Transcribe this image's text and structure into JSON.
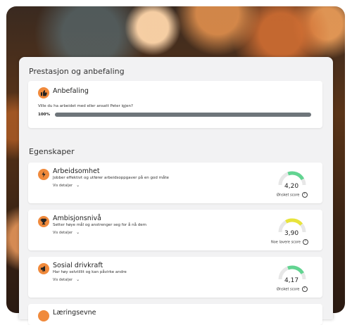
{
  "sections": {
    "performance_title": "Prestasjon og anbefaling",
    "traits_title": "Egenskaper"
  },
  "recommendation": {
    "title": "Anbefaling",
    "question": "Ville du ha arbeidet med eller ansatt Peter igjen?",
    "percent_label": "100%",
    "percent_value": 1.0,
    "icon": "thumbs-up-icon"
  },
  "traits": [
    {
      "title": "Arbeidsomhet",
      "description": "Jobber effektivt og utfører arbeidsoppgaver på en god måte",
      "details_label": "Vis detaljer",
      "score": "4,20",
      "score_value": 4.2,
      "score_label": "Ønsket score",
      "gauge_color": "#62d491",
      "icon": "lightning-icon"
    },
    {
      "title": "Ambisjonsnivå",
      "description": "Setter høye mål og anstrenger seg for å nå dem",
      "details_label": "Vis detaljer",
      "score": "3,90",
      "score_value": 3.9,
      "score_label": "Noe lavere score",
      "gauge_color": "#e8e43a",
      "icon": "trophy-icon"
    },
    {
      "title": "Sosial drivkraft",
      "description": "Har høy selvtillit og kan påvirke andre",
      "details_label": "Vis detaljer",
      "score": "4,17",
      "score_value": 4.17,
      "score_label": "Ønsket score",
      "gauge_color": "#62d491",
      "icon": "megaphone-icon"
    }
  ],
  "partial_card_title": "Læringsevne",
  "colors": {
    "accent": "#f08a3c",
    "bar": "#6e757a"
  }
}
